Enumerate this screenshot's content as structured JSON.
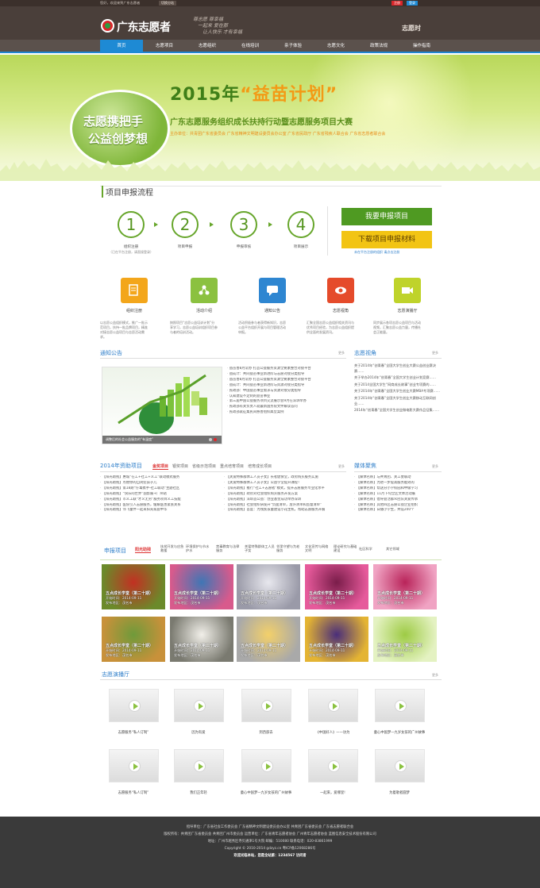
{
  "topbar": {
    "welcome": "您好，欢迎来到广东志愿者",
    "switch_label": "切换分站",
    "register": "注册",
    "login": "登录"
  },
  "header": {
    "logo_text": "广东志愿者",
    "slogan_line1": "尊志愿 尊幸福",
    "slogan_line2": "一起来 爱在那",
    "slogan_line3": "让人快乐 才有幸福",
    "brand_right": "志愿时"
  },
  "nav": {
    "items": [
      "首页",
      "志愿项目",
      "志愿组织",
      "在线培训",
      "亲子体验",
      "志愿文化",
      "政策法规",
      "操作指南"
    ]
  },
  "banner": {
    "bubble_line1": "志愿携把手",
    "bubble_line2": "公益创梦想",
    "year": "2015年",
    "quote_title": "“益苗计划”",
    "subtitle": "广东志愿服务组织成长扶持行动暨志愿服务项目大赛",
    "organizers": "主办单位：共青团广东省委员会 广东省精神文明建设委员会办公室 广东省民政厅 广东省残疾人联合会 广东省志愿者联合会"
  },
  "process": {
    "title": "项目申报流程",
    "steps": [
      {
        "num": "1",
        "label": "组织注册",
        "note": "（已在平台注册，请直接登录）"
      },
      {
        "num": "2",
        "label": "项目申报",
        "note": ""
      },
      {
        "num": "3",
        "label": "申报审核",
        "note": ""
      },
      {
        "num": "4",
        "label": "项目展示",
        "note": ""
      }
    ],
    "apply_button": "我要申报项目",
    "download_button": "下载项目申报材料",
    "hint": "未在平台注册的组织 请点击注册"
  },
  "features": [
    {
      "label": "组织注册",
      "color": "#f3a61b",
      "icon": "document-icon",
      "desc": "以志愿公益组织模式，推广一批示范项目，扶持一批品牌项目，精准对接志愿公益项目与志愿活动需求。"
    },
    {
      "label": "活动介绍",
      "color": "#8bc140",
      "icon": "network-icon",
      "desc": "按照项目“志愿公益培训计划”分享学习，志愿公益培训组织项目参与者的培训活动。"
    },
    {
      "label": "通知公告",
      "color": "#2e86d1",
      "icon": "chat-icon",
      "desc": "活动积极参与者获得新知识，志愿公益平台组织开展与项目管理活动申报。"
    },
    {
      "label": "志愿视角",
      "color": "#e54b2b",
      "icon": "eye-icon",
      "desc": "汇聚全国志愿公益组织相关资讯与优秀项目经验，为志愿公益组织提供全面的发展资讯。"
    },
    {
      "label": "志愿演播厅",
      "color": "#bfd32b",
      "icon": "video-icon",
      "desc": "同步展示各项志愿公益项目与活动视频，汇聚志愿公益力量，传播社会正能量。"
    }
  ],
  "notice": {
    "title": "通知公告",
    "more": "更多",
    "slide_caption": "调整后的社会公益服务的“有温度”",
    "items": [
      "益苗善8月常办 打造公益服务资源全要素整合对接平台",
      "益成计：共同益苗事业新进阶与志愿对接分类指导",
      "益苗善8月常办 打造公益服务资源全要素整合对接平台",
      "益成计：共同益苗事业新进阶与资源对接分类指导",
      "民政部：中国益苗事业需求与资源对接分类指导",
      "认知建设不定制的益苗事业",
      "第三届中国公益服务项目交流展示会9月在深圳举办",
      "民政部有关负责人就最新国务院文件解读答问",
      "民政部就征集民间慈善组织典型案例"
    ]
  },
  "perspective": {
    "title": "志愿视角",
    "more": "更多",
    "items": [
      "关于2014年“创青春”全国大学生创业大赛公益创业赛决赛……",
      "关于举办2014年“创青春”全国大学生创业计划竞赛……",
      "关于2014全国大学生“网商成长故事”创业专项赛的……",
      "关于2014年“创青春”全国大学生创业大赛MBA专项赛……",
      "关于2014年“创青春”全国大学生创业大赛移动互联网创业……",
      "2014年“创青春”全国大学生创业微电影大赛作品征集……"
    ]
  },
  "funding": {
    "title": "2014年资助项目",
    "more": "更多",
    "tabs": [
      "金奖项目",
      "银奖项目",
      "省级示范项目",
      "重点培育项目",
      "培育成长项目"
    ],
    "col1": [
      "【阳光助残】惠城“在工+社工+义工”联动模式服务",
      "【阳光助残】点燃你的自闭症孩子儿",
      "【阳光助残】第18期“仔毒携手-社工联动”主题社区",
      "【阳光助残】“快乐的世界”国影展+广州站",
      "【阳光助残】市义工联“才义无穷”服务项目义工技能",
      "【阳光助残】医院引入志愿服务，缓解医患紧张关系",
      "【阳光助残】邻飞童伴一起来阳光家庭中华"
    ],
    "col2": [
      "【关爱特殊群体工人员子女】长者健食堂，政府购买服务实施",
      "【关爱特殊群体工人员子女】公益学堂提升课程！",
      "【阳光助残】推行“社工+志愿者”模式，提升志愿服务专业化水平",
      "【阳光助残】政府对社会组织购买服务开发方案",
      "【阳光助残】深圳首公益：创业基金成功举办深圳",
      "【阳光助残】社会组织研发开“负面清单，准许清单和监督清单”",
      "【阳光助残】首度：为残疾孩童建设小花生机，帮助志愿服务开展"
    ]
  },
  "media": {
    "title": "媒体聚焦",
    "more": "更多",
    "items": [
      "【媒体名称】与共青团、关工委联动",
      "【媒体名称】为进一步提高服务能效的",
      "【媒体名称】帮送分小学校园和中级学习",
      "【媒体名称】11月下旬全区文体活动展",
      "【媒体名称】倡导益活群众团队关爱传承",
      "【媒体名称】其他四区志愿公益企业组织",
      "【媒体名称】日播小学生，共设200个"
    ]
  },
  "apply_section": {
    "title": "申报项目",
    "tabs": [
      "阳光助残",
      "扶贫开发与应急救援",
      "环境保护与节水护水",
      "禁毒教育与法律服务",
      "关爱特殊群体工人员子女",
      "邻里守望与为老服务",
      "文化宣传与网络文明",
      "理论研究与基础建设",
      "社区科学",
      "其它领域"
    ],
    "tiles": [
      {
        "title": "五点成长学堂（第二十期）",
        "start": "开始时间：2014-09-11",
        "area": "发布地区：茂名市",
        "c1": "#c23022",
        "c2": "#6b8a2a"
      },
      {
        "title": "五点成长学堂（第二十期）",
        "start": "开始时间：2014-09-11",
        "area": "发布地区：茂名市",
        "c1": "#3f76b5",
        "c2": "#d85a8c"
      },
      {
        "title": "五点成长学堂（第二十期）",
        "start": "开始时间：2014-09-11",
        "area": "发布地区：茂名市",
        "c1": "#e8e8ee",
        "c2": "#9a9aa8"
      },
      {
        "title": "五点成长学堂（第二十期）",
        "start": "开始时间：2014-09-11",
        "area": "发布地区：茂名市",
        "c1": "#7a1d4a",
        "c2": "#e65a9b"
      },
      {
        "title": "五点成长学堂（第二十期）",
        "start": "开始时间：2014-09-11",
        "area": "发布地区：茂名市",
        "c1": "#b9245a",
        "c2": "#f0a3c3"
      },
      {
        "title": "五点成长学堂（第二十期）",
        "start": "开始时间：2014-09-11",
        "area": "发布地区：茂名市",
        "c1": "#6f9a3a",
        "c2": "#c8913a"
      },
      {
        "title": "五点成长学堂（第二十期）",
        "start": "开始时间：2014-09-11",
        "area": "发布地区：茂名市",
        "c1": "#f1efe9",
        "c2": "#7a7a70"
      },
      {
        "title": "五点成长学堂（第二十期）",
        "start": "开始时间：2014-09-11",
        "area": "发布地区：茂名市",
        "c1": "#f3d06a",
        "c2": "#a9a9a9"
      },
      {
        "title": "五点成长学堂（第二十期）",
        "start": "开始时间：2014-09-11",
        "area": "发布地区：茂名市",
        "c1": "#4a2e7a",
        "c2": "#e4b433"
      },
      {
        "title": "五点成长学堂（第二十期）",
        "start": "开始时间：2014-09-11",
        "area": "发布地区：茂名市",
        "c1": "#9ecb45",
        "c2": "#e4f2c2"
      }
    ]
  },
  "videos": {
    "title": "志愿演播厅",
    "more": "更多",
    "row1": [
      "志愿服务“私人订制”",
      "因为有爱",
      "到西部去",
      "《中国好人》——访为",
      "童心中国梦—九岁女孩的广州故事"
    ],
    "row2": [
      "志愿服务“私人订制”",
      "我们正年轻",
      "童心中国梦—九岁女孩的广州故事",
      "一起来，爱哪里!",
      "为着歌者圆梦"
    ]
  },
  "footer": {
    "lines": [
      "指导单位：广东省社会工作委员会  广东省精神文明建设委员会办公室  共青团广东省委员会  广东省志愿者联合会",
      "版权所有：共青团广东省委员会  共青团广州市委员会  运营单位：广东省青年志愿者协会  广州青年志愿者协会  蓝图信息安全技术股份有限公司",
      "地址：广州市越秀区寺贝通津1号大院  邮编：510080  联系电话：020-83861999",
      "Copyright © 2010-2014 gdzyz.cn 粤ICP备12068286号",
      "欢迎光临本站，您是全站第：1234567 访问者"
    ]
  }
}
